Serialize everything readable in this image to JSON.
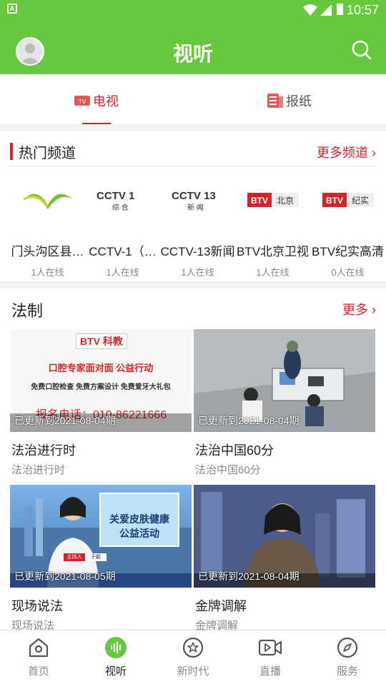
{
  "status_bar": {
    "time": "10:57",
    "app_icon_letter": "A"
  },
  "header": {
    "title": "视听"
  },
  "tabs": [
    {
      "label": "电视",
      "icon": "tv-icon"
    },
    {
      "label": "报纸",
      "icon": "newspaper-icon"
    }
  ],
  "hot_channels": {
    "title": "热门频道",
    "more_label": "更多频道",
    "channels": [
      {
        "name": "门头沟区县…",
        "online": "1人在线"
      },
      {
        "name": "CCTV-1（…",
        "online": "1人在线",
        "logo_text": "CCTV 1",
        "logo_sub": "综 合"
      },
      {
        "name": "CCTV-13新闻",
        "online": "1人在线",
        "logo_text": "CCTV 13",
        "logo_sub": "新 闻"
      },
      {
        "name": "BTV北京卫视",
        "online": "1人在线",
        "logo_text": "BTV",
        "logo_sub": "北京"
      },
      {
        "name": "BTV纪实高清",
        "online": "0人在线",
        "logo_text": "BTV",
        "logo_sub": "纪实"
      }
    ]
  },
  "law_section": {
    "title": "法制",
    "more_label": "更多",
    "items": [
      {
        "title": "法治进行时",
        "subtitle": "法治进行时",
        "updated": "已更新到2021-08-04期",
        "thumb_text": [
          "BTV 科教",
          "口腔专家面对面 公益行动",
          "免费口腔检查 免费方案设计 免费爱牙大礼包",
          "报名电话：010-86221666"
        ]
      },
      {
        "title": "法治中国60分",
        "subtitle": "法治中国60分",
        "updated": "已更新到2021-08-04期"
      },
      {
        "title": "现场说法",
        "subtitle": "现场说法",
        "updated": "已更新到2021-08-05期",
        "thumb_text": [
          "关爱皮肤健康",
          "公益活动",
          "主持人",
          "子叡"
        ]
      },
      {
        "title": "金牌调解",
        "subtitle": "金牌调解",
        "updated": "已更新到2021-08-04期"
      }
    ]
  },
  "bottom_nav": [
    {
      "label": "首页",
      "icon": "home-icon"
    },
    {
      "label": "视听",
      "icon": "audio-wave-icon"
    },
    {
      "label": "新时代",
      "icon": "star-circle-icon"
    },
    {
      "label": "直播",
      "icon": "video-camera-icon"
    },
    {
      "label": "服务",
      "icon": "compass-icon"
    }
  ],
  "colors": {
    "brand_green": "#66c83d",
    "accent_red": "#d3242a"
  }
}
